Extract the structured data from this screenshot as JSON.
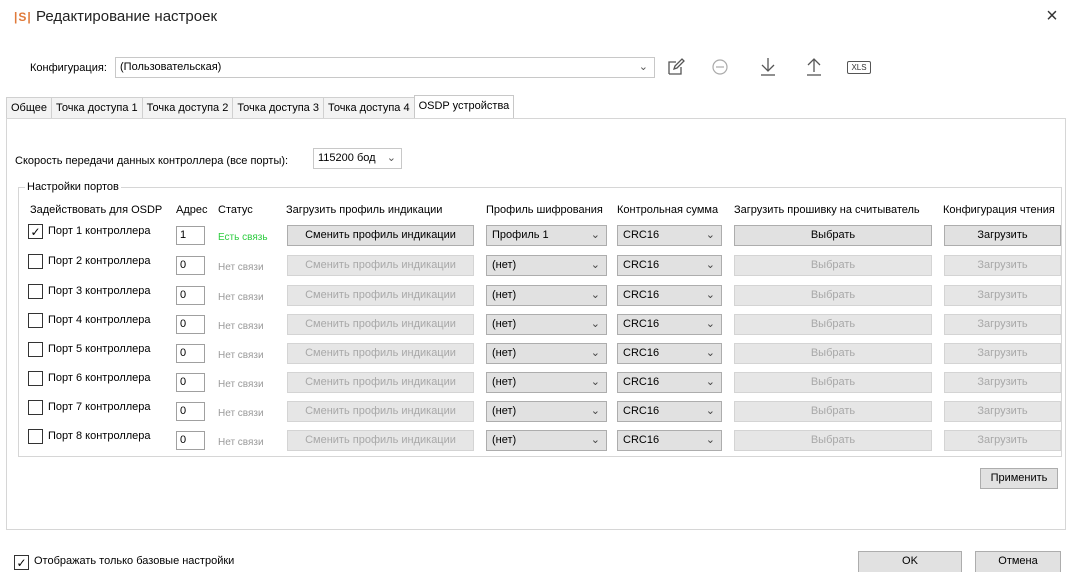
{
  "window": {
    "logo": "|S|",
    "title": "Редактирование настроек",
    "close": "×"
  },
  "config": {
    "label": "Конфигурация:",
    "value": "(Пользовательская)",
    "xls": "XLS"
  },
  "tabs": [
    {
      "label": "Общее",
      "active": false
    },
    {
      "label": "Точка доступа 1",
      "active": false
    },
    {
      "label": "Точка доступа 2",
      "active": false
    },
    {
      "label": "Точка доступа 3",
      "active": false
    },
    {
      "label": "Точка доступа 4",
      "active": false
    },
    {
      "label": "OSDP устройства",
      "active": true
    }
  ],
  "speed": {
    "label": "Скорость передачи данных контроллера (все порты):",
    "value": "115200 бод"
  },
  "ports_group": {
    "title": "Настройки портов",
    "headers": {
      "enable": "Задействовать для OSDP",
      "address": "Адрес",
      "status": "Статус",
      "indication": "Загрузить профиль индикации",
      "encryption": "Профиль шифрования",
      "checksum": "Контрольная сумма",
      "firmware": "Загрузить прошивку на считыватель",
      "read_config": "Конфигурация чтения"
    },
    "rows": [
      {
        "checked": true,
        "label": "Порт 1 контроллера",
        "address": "1",
        "status": "Есть связь",
        "connected": true,
        "indication_btn": "Сменить профиль индикации",
        "encryption": "Профиль 1",
        "checksum": "CRC16",
        "firmware_btn": "Выбрать",
        "read_btn": "Загрузить"
      },
      {
        "checked": false,
        "label": "Порт 2 контроллера",
        "address": "0",
        "status": "Нет связи",
        "connected": false,
        "indication_btn": "Сменить профиль индикации",
        "encryption": "(нет)",
        "checksum": "CRC16",
        "firmware_btn": "Выбрать",
        "read_btn": "Загрузить"
      },
      {
        "checked": false,
        "label": "Порт 3 контроллера",
        "address": "0",
        "status": "Нет связи",
        "connected": false,
        "indication_btn": "Сменить профиль индикации",
        "encryption": "(нет)",
        "checksum": "CRC16",
        "firmware_btn": "Выбрать",
        "read_btn": "Загрузить"
      },
      {
        "checked": false,
        "label": "Порт 4 контроллера",
        "address": "0",
        "status": "Нет связи",
        "connected": false,
        "indication_btn": "Сменить профиль индикации",
        "encryption": "(нет)",
        "checksum": "CRC16",
        "firmware_btn": "Выбрать",
        "read_btn": "Загрузить"
      },
      {
        "checked": false,
        "label": "Порт 5 контроллера",
        "address": "0",
        "status": "Нет связи",
        "connected": false,
        "indication_btn": "Сменить профиль индикации",
        "encryption": "(нет)",
        "checksum": "CRC16",
        "firmware_btn": "Выбрать",
        "read_btn": "Загрузить"
      },
      {
        "checked": false,
        "label": "Порт 6 контроллера",
        "address": "0",
        "status": "Нет связи",
        "connected": false,
        "indication_btn": "Сменить профиль индикации",
        "encryption": "(нет)",
        "checksum": "CRC16",
        "firmware_btn": "Выбрать",
        "read_btn": "Загрузить"
      },
      {
        "checked": false,
        "label": "Порт 7 контроллера",
        "address": "0",
        "status": "Нет связи",
        "connected": false,
        "indication_btn": "Сменить профиль индикации",
        "encryption": "(нет)",
        "checksum": "CRC16",
        "firmware_btn": "Выбрать",
        "read_btn": "Загрузить"
      },
      {
        "checked": false,
        "label": "Порт 8 контроллера",
        "address": "0",
        "status": "Нет связи",
        "connected": false,
        "indication_btn": "Сменить профиль индикации",
        "encryption": "(нет)",
        "checksum": "CRC16",
        "firmware_btn": "Выбрать",
        "read_btn": "Загрузить"
      }
    ]
  },
  "apply_label": "Применить",
  "base_only": {
    "checked": true,
    "label": "Отображать только базовые настройки"
  },
  "ok_label": "OK",
  "cancel_label": "Отмена",
  "icons": [
    "edit-icon",
    "remove-icon",
    "download-icon",
    "upload-icon",
    "xls-icon",
    "chevron-down-icon",
    "checkmark-icon",
    "close-icon"
  ],
  "colors": {
    "status_ok": "#2ecc40",
    "status_no": "#9a9a9a",
    "logo": "#e07a3a"
  }
}
